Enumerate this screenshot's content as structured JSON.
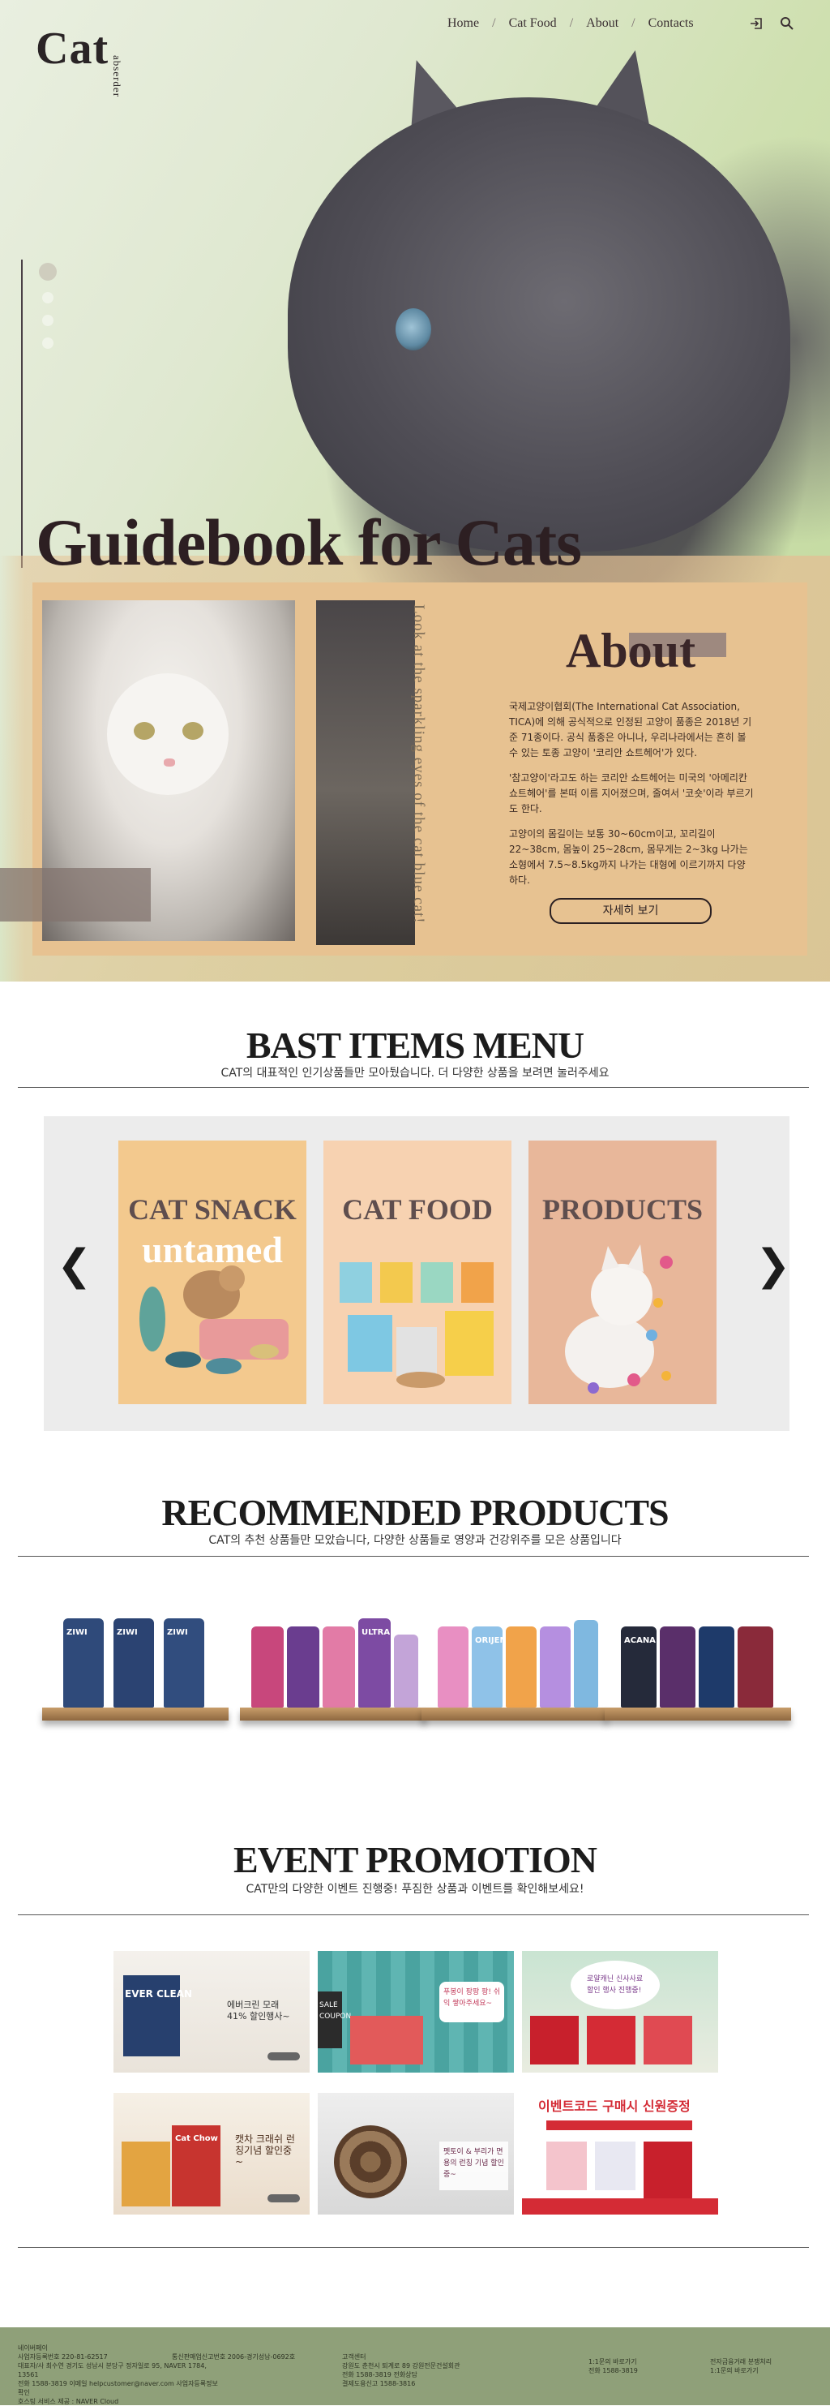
{
  "header": {
    "logo": "Cat",
    "logo_sub": "abserder",
    "nav": [
      "Home",
      "Cat Food",
      "About",
      "Contacts"
    ],
    "separator": "/"
  },
  "hero": {
    "title": "Guidebook for Cats",
    "vertical_caption": "Look at the sparkling eyes of the cat blue cat!",
    "about_title": "About",
    "about_paragraphs": [
      "국제고양이협회(The International Cat Association, TICA)에 의해 공식적으로 인정된 고양이 품종은 2018년 기준 71종이다. 공식 품종은 아니나, 우리나라에서는 흔히 볼 수 있는 토종 고양이 '코리안 쇼트헤어'가 있다.",
      "'참고양이'라고도 하는 코리안 쇼트헤어는 미국의 '아메리칸 쇼트헤어'를 본떠 이름 지어졌으며, 줄여서 '코숏'이라 부르기도 한다.",
      "고양이의 몸길이는 보통 30~60cm이고, 꼬리길이 22~38cm, 몸높이 25~28cm, 몸무게는 2~3kg 나가는 소형에서 7.5~8.5kg까지 나가는 대형에 이르기까지 다양하다."
    ],
    "about_button": "자세히 보기"
  },
  "best": {
    "title": "BAST ITEMS MENU",
    "subtitle": "CAT의 대표적인 인기상품들만 모아뒀습니다. 더 다양한 상품을 보려면 눌러주세요",
    "cards": [
      {
        "title": "CAT SNACK",
        "sub": "untamed"
      },
      {
        "title": "CAT FOOD",
        "sub": ""
      },
      {
        "title": "PRODUCTS",
        "sub": ""
      }
    ],
    "prev": "❮",
    "next": "❯"
  },
  "recommended": {
    "title": "RECOMMENDED PRODUCTS",
    "subtitle": "CAT의 추천 상품들만 모았습니다, 다양한 상품들로 영양과 건강위주를 모은 상품입니다",
    "bag_labels": [
      "ZIWI",
      "ULTRA",
      "ORIJEN",
      "ACANA"
    ]
  },
  "event": {
    "title": "EVENT PROMOTION",
    "subtitle": "CAT만의 다양한 이벤트 진행중! 푸짐한 상품과 이벤트를 확인해보세요!",
    "promos": [
      {
        "brand": "EVER CLEAN",
        "text": "에버크린 모래 41% 할인행사~"
      },
      {
        "brand": "SALE COUPON",
        "text": "푸봉이 팡팡 팡! 쉬익 쌓아주세요~"
      },
      {
        "brand": "",
        "text": "로얄캐닌 신사사료 할인 행사 진행중!"
      },
      {
        "brand": "Cat Chow",
        "text": "캣차 크래쉬 런칭기념 할인중~"
      },
      {
        "brand": "",
        "text": "펫토이 & 부리가 면용의 런칭 기념 할인중~"
      },
      {
        "brand": "",
        "text": "이벤트코드 구매시 신원증정"
      }
    ]
  },
  "footer": {
    "cols": [
      "네이버페이\n사업자등록번호 220-81-62517\n대표자/사 최수연 경기도 성남시 분당구 정자일로 95, NAVER 1784, 13561\n전화 1588-3819 이메일 helpcustomer@naver.com 사업자등록정보 확인\n호스팅 서비스 제공 : NAVER Cloud",
      "통신판매업신고번호 2006-경기성남-0692호",
      "고객센터\n강원도 춘천시 퇴계로 89 강원전문건설회관\n전화 1588-3819 전화상담\n결제도용신고 1588-3816",
      "1:1문의 바로가기\n전화 1588-3819",
      "전자금융거래 분쟁처리\n1:1문의 바로가기"
    ]
  },
  "colors": {
    "about_bg": "#e7c291",
    "footer_bg": "#8fa079",
    "card_bg": [
      "#f3c98e",
      "#f7d2b1",
      "#e8b79a"
    ]
  }
}
